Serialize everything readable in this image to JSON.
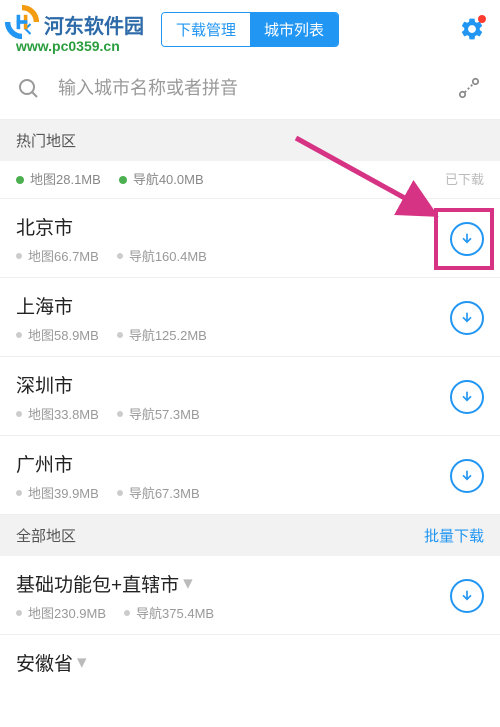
{
  "header": {
    "tabs": [
      "下载管理",
      "城市列表"
    ],
    "active_tab": 1
  },
  "search": {
    "placeholder": "输入城市名称或者拼音"
  },
  "sections": {
    "hot_title": "热门地区",
    "all_title": "全部地区",
    "batch_label": "批量下载"
  },
  "partial_item": {
    "map_label": "地图28.1MB",
    "nav_label": "导航40.0MB",
    "status": "已下载"
  },
  "hot_cities": [
    {
      "name": "北京市",
      "map": "地图66.7MB",
      "nav": "导航160.4MB"
    },
    {
      "name": "上海市",
      "map": "地图58.9MB",
      "nav": "导航125.2MB"
    },
    {
      "name": "深圳市",
      "map": "地图33.8MB",
      "nav": "导航57.3MB"
    },
    {
      "name": "广州市",
      "map": "地图39.9MB",
      "nav": "导航67.3MB"
    }
  ],
  "all_items": [
    {
      "name": "基础功能包+直辖市",
      "map": "地图230.9MB",
      "nav": "导航375.4MB",
      "expandable": true
    },
    {
      "name": "安徽省",
      "expandable": true
    }
  ],
  "watermark": {
    "site": "河东软件园",
    "url": "www.pc0359.cn"
  },
  "colors": {
    "accent": "#2196F3",
    "highlight": "#d63384"
  }
}
